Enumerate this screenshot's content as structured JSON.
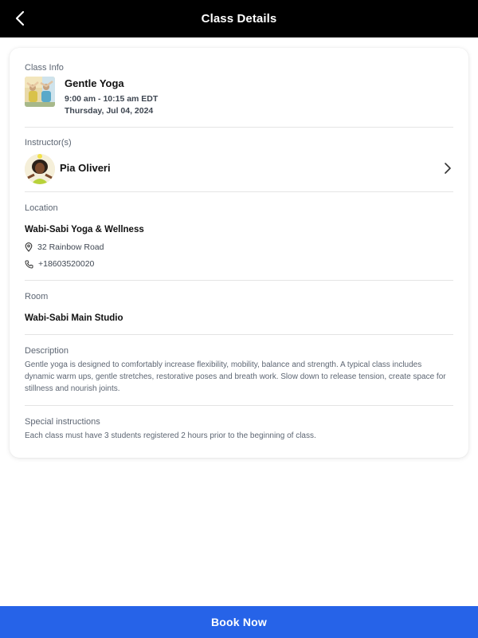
{
  "header": {
    "title": "Class Details",
    "back_icon": "chevron-left-icon"
  },
  "class_info": {
    "label": "Class Info",
    "name": "Gentle Yoga",
    "time": "9:00 am - 10:15 am EDT",
    "date": "Thursday, Jul 04, 2024"
  },
  "instructor": {
    "label": "Instructor(s)",
    "name": "Pia Oliveri"
  },
  "location": {
    "label": "Location",
    "name": "Wabi-Sabi Yoga & Wellness",
    "address": "32 Rainbow Road",
    "phone": "+18603520020"
  },
  "room": {
    "label": "Room",
    "name": "Wabi-Sabi Main Studio"
  },
  "description": {
    "label": "Description",
    "text": "Gentle yoga is designed to comfortably increase flexibility, mobility, balance and strength. A typical class includes dynamic warm ups, gentle stretches, restorative poses and breath work. Slow down to release tension, create space for stillness and nourish joints."
  },
  "special_instructions": {
    "label": "Special instructions",
    "text": "Each class must have 3 students registered 2 hours prior to the beginning of class."
  },
  "footer": {
    "book_label": "Book Now"
  },
  "colors": {
    "header_bg": "#000000",
    "primary_button": "#2663e8",
    "muted_text": "#5d6673",
    "divider": "#e4e4e4"
  }
}
